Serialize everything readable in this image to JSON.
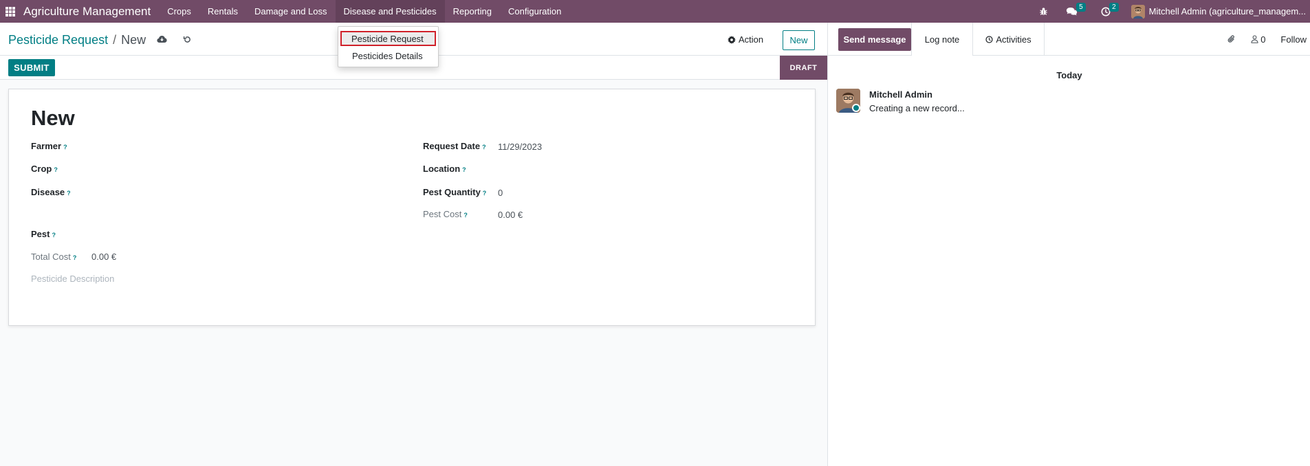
{
  "navbar": {
    "brand": "Agriculture Management",
    "menu": [
      {
        "label": "Crops"
      },
      {
        "label": "Rentals"
      },
      {
        "label": "Damage and Loss"
      },
      {
        "label": "Disease and Pesticides"
      },
      {
        "label": "Reporting"
      },
      {
        "label": "Configuration"
      }
    ],
    "messages_count": "5",
    "activities_count": "2",
    "user_name": "Mitchell Admin (agriculture_managem..."
  },
  "dropdown": {
    "items": [
      {
        "label": "Pesticide Request"
      },
      {
        "label": "Pesticides Details"
      }
    ]
  },
  "control_panel": {
    "breadcrumb_parent": "Pesticide Request",
    "breadcrumb_separator": "/",
    "breadcrumb_current": "New",
    "action_label": "Action",
    "new_label": "New"
  },
  "statusbar": {
    "submit_label": "SUBMIT",
    "stage_label": "DRAFT"
  },
  "form": {
    "title": "New",
    "help_mark": "?",
    "farmer_label": "Farmer",
    "crop_label": "Crop",
    "disease_label": "Disease",
    "pest_label": "Pest",
    "total_cost_label": "Total Cost",
    "total_cost_value": "0.00 €",
    "description_placeholder": "Pesticide Description",
    "request_date_label": "Request Date",
    "request_date_value": "11/29/2023",
    "location_label": "Location",
    "pest_quantity_label": "Pest Quantity",
    "pest_quantity_value": "0",
    "pest_cost_label": "Pest Cost",
    "pest_cost_value": "0.00 €"
  },
  "chatter": {
    "send_message_label": "Send message",
    "log_note_label": "Log note",
    "activities_label": "Activities",
    "followers_count": "0",
    "follow_label": "Follow",
    "today_label": "Today",
    "message_author": "Mitchell Admin",
    "message_body": "Creating a new record..."
  },
  "colors": {
    "brand_purple": "#714b67",
    "accent_teal": "#017e84",
    "highlight_red": "#d0212a"
  }
}
